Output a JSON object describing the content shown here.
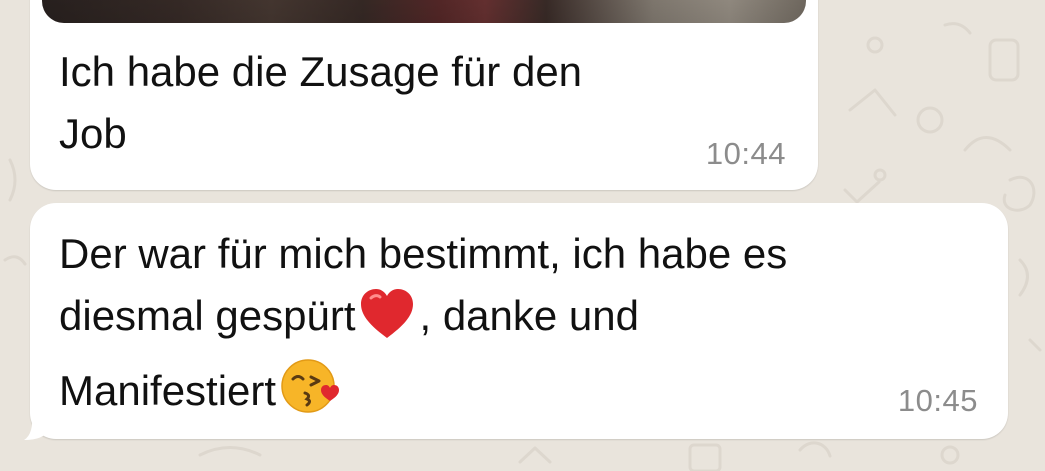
{
  "chat": {
    "messages": [
      {
        "line1": "Ich habe die Zusage für den",
        "line2": "Job",
        "time": "10:44",
        "has_image": true
      },
      {
        "line1": "Der war für mich bestimmt, ich habe es",
        "line2_before": "diesmal gespürt",
        "line2_after": ", danke und",
        "line3": "Manifestiert",
        "time": "10:45",
        "emojis": [
          "red-heart-emoji",
          "face-blowing-kiss-emoji"
        ]
      }
    ]
  },
  "colors": {
    "background": "#e9e4dc",
    "bubble": "#ffffff",
    "text": "#111111",
    "timestamp": "#8c8c8c",
    "heart": "#e0282e",
    "emoji_face": "#f7b528"
  }
}
